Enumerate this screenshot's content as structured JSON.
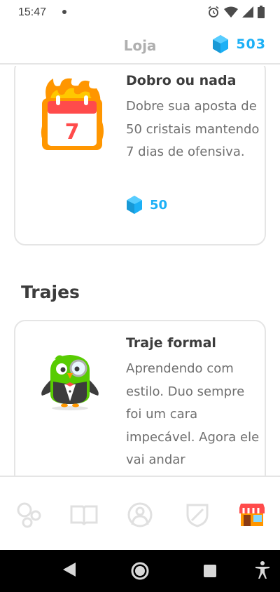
{
  "status_bar": {
    "time": "15:47"
  },
  "header": {
    "title": "Loja",
    "gems": "503"
  },
  "shop": {
    "items": [
      {
        "title": "Dobro ou nada",
        "description": "Dobre sua aposta de 50 cristais mantendo 7 dias de ofensiva.",
        "calendar_number": "7",
        "price": "50"
      },
      {
        "title": "Traje formal",
        "description": "Aprendendo com estilo. Duo sempre foi um cara impecável. Agora ele vai andar"
      }
    ],
    "section_outfits": "Trajes"
  },
  "bottom_nav": {
    "items": [
      "learn",
      "stories",
      "profile",
      "leagues",
      "shop"
    ],
    "active": "shop"
  },
  "colors": {
    "gem_blue": "#1cb0f6",
    "border": "#e5e5e5",
    "title_gray": "#afafaf",
    "text": "#3c3c3c",
    "desc": "#6f6f6f"
  }
}
